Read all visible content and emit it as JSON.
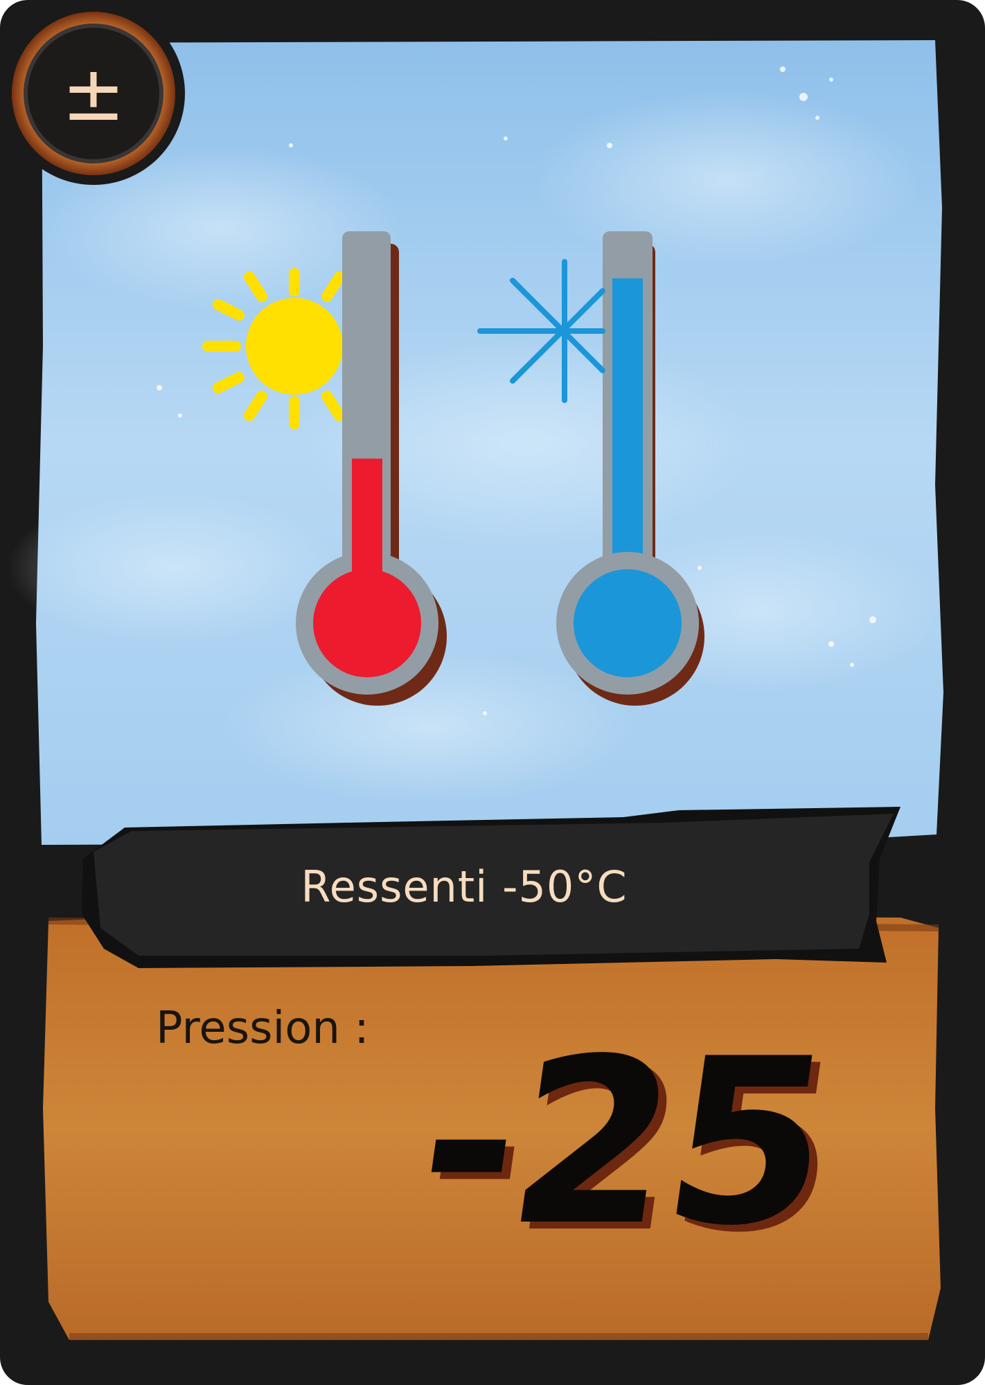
{
  "card": {
    "badge_symbol": "±",
    "banner_text": "Ressenti -50°C",
    "stat_label": "Pression :",
    "stat_value": "-25",
    "icons": [
      "sun-icon",
      "thermometer-hot-icon",
      "snowflake-icon",
      "thermometer-cold-icon"
    ],
    "colors": {
      "frame": "#1b1a1a",
      "sky": "#a9cff0",
      "parchment": "#c97d33",
      "hot": "#ec1b2e",
      "cold": "#1b96d9",
      "sun": "#ffe000",
      "tube": "#929ca4",
      "badge_ring": "#b5561f"
    },
    "thermometer_levels": {
      "hot_fill_fraction": 0.42,
      "cold_fill_fraction": 0.88
    }
  }
}
